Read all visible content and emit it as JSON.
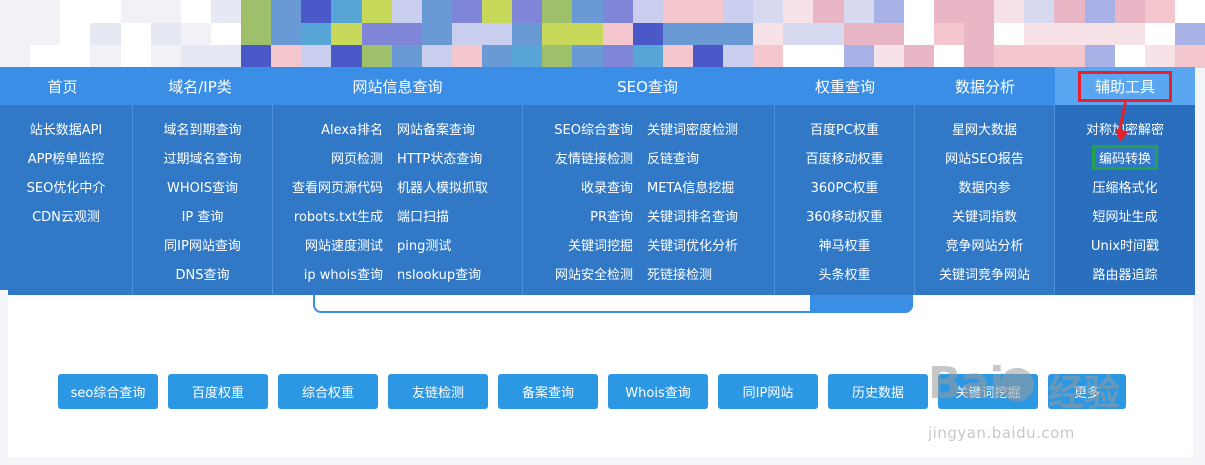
{
  "nav": {
    "items": [
      "首页",
      "域名/IP类",
      "网站信息查询",
      "SEO查询",
      "权重查询",
      "数据分析",
      "辅助工具"
    ],
    "active_index": 6
  },
  "menu": {
    "col0": [
      "站长数据API",
      "APP榜单监控",
      "SEO优化中介",
      "CDN云观测"
    ],
    "col1": [
      "域名到期查询",
      "过期域名查询",
      "WHOIS查询",
      "IP 查询",
      "同IP网站查询",
      "DNS查询"
    ],
    "col2_left": [
      "Alexa排名",
      "网页检测",
      "查看网页源代码",
      "robots.txt生成",
      "网站速度测试",
      "ip whois查询"
    ],
    "col2_right": [
      "网站备案查询",
      "HTTP状态查询",
      "机器人模拟抓取",
      "端口扫描",
      "ping测试",
      "nslookup查询"
    ],
    "col3_left": [
      "SEO综合查询",
      "友情链接检测",
      "收录查询",
      "PR查询",
      "关键词挖掘",
      "网站安全检测"
    ],
    "col3_right": [
      "关键词密度检测",
      "反链查询",
      "META信息挖掘",
      "关键词排名查询",
      "关键词优化分析",
      "死链接检测"
    ],
    "col4": [
      "百度PC权重",
      "百度移动权重",
      "360PC权重",
      "360移动权重",
      "神马权重",
      "头条权重"
    ],
    "col5": [
      "星网大数据",
      "网站SEO报告",
      "数据内参",
      "关键词指数",
      "竞争网站分析",
      "关键词竞争网站"
    ],
    "col6": [
      "对称加密解密",
      "编码转换",
      "压缩格式化",
      "短网址生成",
      "Unix时间戳",
      "路由器追踪"
    ]
  },
  "quick_buttons": [
    "seo综合查询",
    "百度权重",
    "综合权重",
    "友链检测",
    "备案查询",
    "Whois查询",
    "同IP网站",
    "历史数据",
    "关键词挖掘",
    "更多"
  ],
  "watermark": {
    "brand": "Bai",
    "brand_suffix": "du",
    "cn": "经验",
    "url": "jingyan.baidu.com"
  },
  "colors": {
    "nav_bg": "#3a8ee6",
    "menu_bg": "#3179c7",
    "highlight_red": "#e8202a",
    "highlight_green": "#22a24a",
    "button_bg": "#2c97e3"
  }
}
